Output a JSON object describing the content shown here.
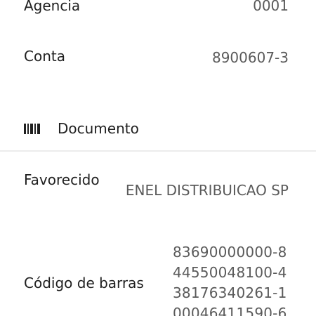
{
  "details": {
    "agencia": {
      "label": "Agencia",
      "value": "0001"
    },
    "conta": {
      "label": "Conta",
      "value": "8900607-3"
    }
  },
  "documento": {
    "icon": "barcode-icon",
    "title": "Documento",
    "favorecido": {
      "label": "Favorecido",
      "value": "ENEL DISTRIBUICAO SP"
    },
    "codigo_barras": {
      "label": "Código de barras",
      "value": "83690000000-844550048100-438176340261-100046411590-6"
    }
  },
  "colors": {
    "label_text": "#1f1f1f",
    "value_text": "#5a5a5a",
    "divider": "#ececec",
    "background": "#ffffff"
  }
}
